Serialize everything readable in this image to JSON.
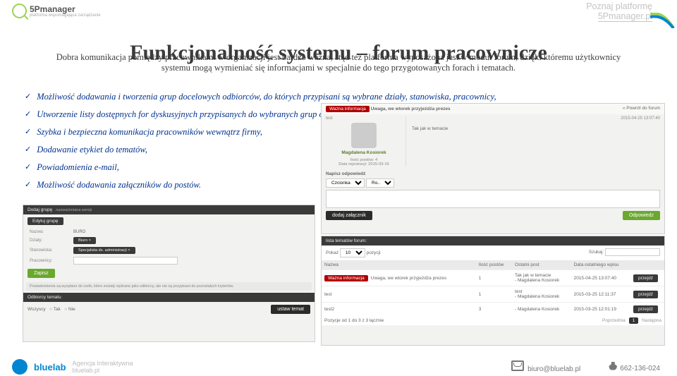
{
  "header": {
    "brand": "5Pmanager",
    "brand_sub": "platforma wspomagająca zarządzanie",
    "corner_line1": "Poznaj platformę",
    "corner_line2": "5Pmanager.pl"
  },
  "title": "Funkcjonalność systemu – forum pracownicze",
  "intro": "Dobra komunikacja pomiędzy pracownikami w organizacji jest bardzo ważna, stąd też platforma wyposażona jest w moduł forum, dzięki któremu użytkownicy systemu mogą wymieniać się informacjami w specjalnie do tego przygotowanych forach i tematach.",
  "bullets": [
    "Możliwość dodawania i tworzenia  grup docelowych odbiorców, do których przypisani są wybrane działy, stanowiska, pracownicy,",
    "Utworzenie listy dostępnych for dyskusyjnych przypisanych do wybranych grup odbiorców,",
    "Szybka i bezpieczna komunikacja pracowników wewnątrz firmy,",
    "Dodawanie etykiet do tematów,",
    "Powiadomienia e-mail,",
    "Możliwość dodawania załączników do postów."
  ],
  "shot_left": {
    "panel1_title": "Dodaj grupę",
    "panel1_sub": "nazwa/zmiana wersji",
    "label_edit": "Edytuj grupę",
    "field_name_label": "Nazwa:",
    "field_name_value": "BURO",
    "field_depts_label": "Działy:",
    "field_depts_value": "Biuro ×",
    "field_positions_label": "Stanowiska:",
    "field_positions_value": "Specjalista ds. administracji ×",
    "field_workers_label": "Pracownicy:",
    "field_workers_value": "",
    "save": "Zapisz",
    "note": "Powiadomienia są wysyłane do osób, które zostały wybrane jako odbiorcy, ale nie są przypisani do pozostałych kryteriów.",
    "panel2_title": "Odbiorcy tematu",
    "chk_all": "Wszyscy",
    "opt1": "Tak",
    "opt2": "Nie",
    "next": "ustaw temat"
  },
  "shot_topic": {
    "breadcrumb": "« Powrót do forum",
    "badge": "Ważna informacja",
    "badge_text": "Uwaga, we wtorek przyjeżdża prezes",
    "reply_to": "test",
    "post_date": "2015-04-25 13:07:40",
    "post_body": "Tak jak w temacie",
    "user_name": "Magdalena Kosiorek",
    "user_posts_label": "Ilość postów:",
    "user_posts_val": "4",
    "user_reg_label": "Data rejestracji:",
    "user_reg_val": "2015-03-16",
    "reply_header": "Napisz odpowiedź",
    "font_a": "Czcionka",
    "font_b": "Ro..",
    "attach": "dodaj załącznik",
    "answer": "Odpowiedz"
  },
  "shot_list": {
    "panel_title": "lista tematów forum:",
    "show_lbl": "Pokaż",
    "show_val": "10",
    "show_suffix": "pozycji",
    "search_lbl": "Szukaj:",
    "cols": [
      "Nazwa",
      "Ilość postów",
      "Ostatni post",
      "Data ostatniego wpisu"
    ],
    "rows": [
      {
        "badge": "Ważna informacja",
        "name": "Uwaga, we wtorek przyjeżdża prezes",
        "posts": "1",
        "last": "Tak jak w temacie\n- Magdalena Kosiorek",
        "date": "2015-04-25 13:07:40",
        "action": "przejdź"
      },
      {
        "badge": "",
        "name": "test",
        "posts": "1",
        "last": "test\n- Magdalena Kosiorek",
        "date": "2015-03-25 12:11:37",
        "action": "przejdź"
      },
      {
        "badge": "",
        "name": "test2",
        "posts": "3",
        "last": "- Magdalena Kosiorek",
        "date": "2015-03-25 12:01:19",
        "action": "przejdź"
      }
    ],
    "pager_info": "Pozycje od 1 do 3 z 3 łącznie",
    "prev": "Poprzednia",
    "page": "1",
    "next": "Następna"
  },
  "footer": {
    "brand": "bluelab",
    "sub1": "Agencja Interaktywna",
    "sub2": "bluelab.pl",
    "email": "biuro@bluelab.pl",
    "phone": "662-136-024"
  }
}
